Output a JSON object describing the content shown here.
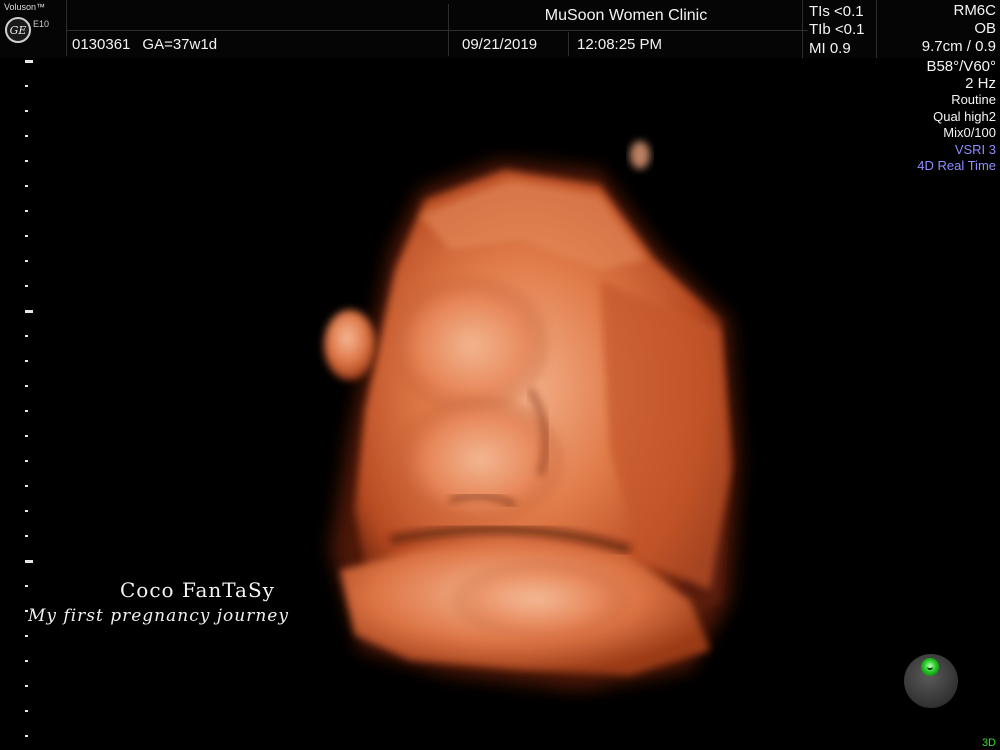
{
  "header": {
    "brand": "Voluson™",
    "logo": "GE",
    "model": "E10",
    "patient_id": "0130361",
    "gestational_age": "GA=37w1d",
    "clinic": "MuSoon Women Clinic",
    "date": "09/21/2019",
    "time": "12:08:25 PM",
    "tis": "TIs <0.1",
    "tib": "TIb <0.1",
    "mi": "MI  0.9",
    "probe": "RM6C",
    "application": "OB",
    "depth": "9.7cm / 0.9"
  },
  "params": {
    "angle": "B58°/V60°",
    "frequency": "2 Hz",
    "mode": "Routine",
    "quality": "Qual high2",
    "mix": "Mix0/100",
    "vsri": "VSRI 3",
    "realtime": "4D Real Time"
  },
  "watermark": {
    "title": "Coco FanTaSy",
    "subtitle": "My first pregnancy journey"
  },
  "footer": {
    "mode": "3D"
  },
  "colors": {
    "background": "#000000",
    "accent_blue": "#8f8dff",
    "trackball_green": "#22c922",
    "render_tone": "#d9683a"
  },
  "icons": {
    "logo": "ge-logo-icon",
    "trackball": "trackball-icon"
  }
}
